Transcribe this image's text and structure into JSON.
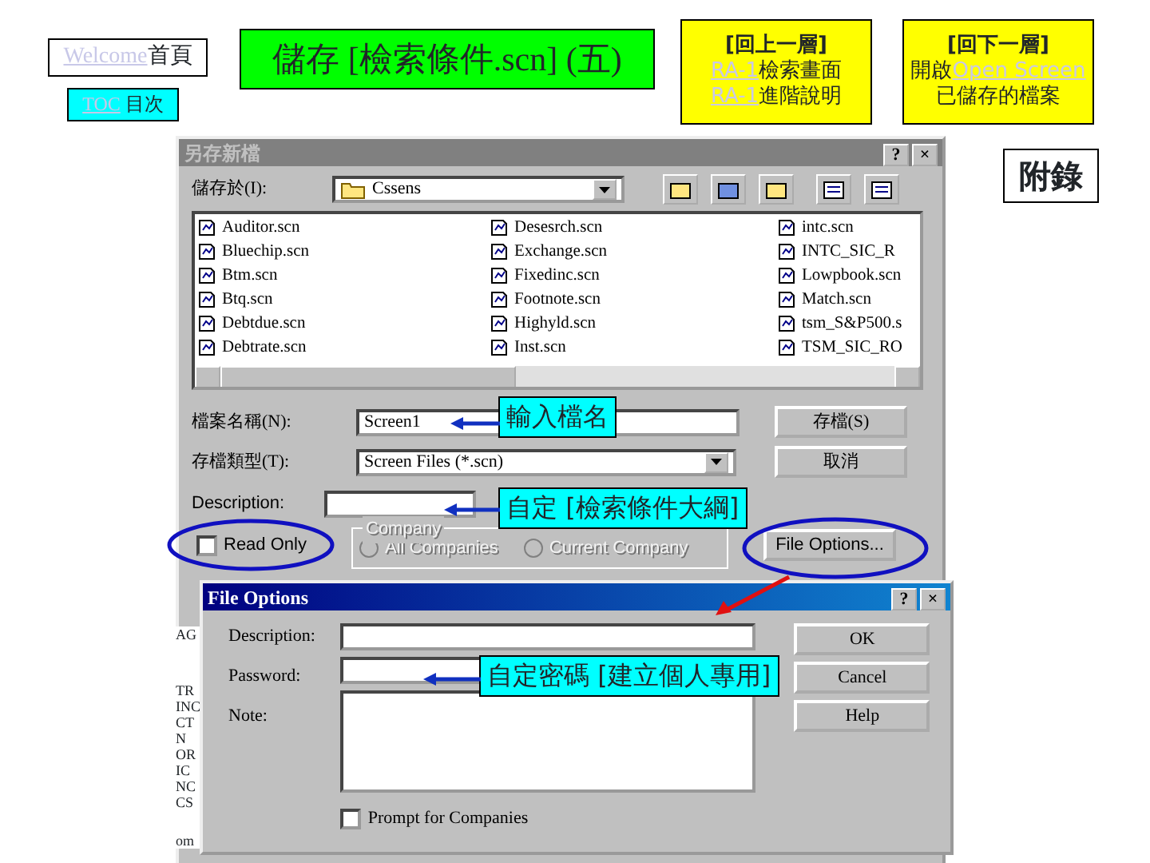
{
  "nav": {
    "home": {
      "link": "Welcome",
      "text": "首頁"
    },
    "toc": {
      "link": "TOC",
      "text": "目次"
    }
  },
  "title": "儲存 [檢索條件.scn] (五)",
  "nav_up": {
    "lines": [
      [
        {
          "kind": "bold",
          "text": "[回上一層]"
        }
      ],
      [
        {
          "kind": "link",
          "text": "RA-1"
        },
        {
          "kind": "text",
          "text": "檢索畫面"
        }
      ],
      [
        {
          "kind": "link",
          "text": "RA-1"
        },
        {
          "kind": "text",
          "text": "進階說明"
        }
      ]
    ]
  },
  "nav_down": {
    "lines": [
      [
        {
          "kind": "bold",
          "text": "[回下一層]"
        }
      ],
      [
        {
          "kind": "text",
          "text": "開啟"
        },
        {
          "kind": "link",
          "text": "Open Screen"
        }
      ],
      [
        {
          "kind": "text",
          "text": "已儲存的檔案"
        }
      ]
    ]
  },
  "appendix": "附錄",
  "save_dialog": {
    "title": "另存新檔",
    "help": "?",
    "close": "×",
    "save_in_label": "儲存於(I):",
    "folder": "Cssens",
    "files": [
      {
        "name": "Auditor.scn"
      },
      {
        "name": "Desesrch.scn"
      },
      {
        "name": "intc.scn"
      },
      {
        "name": "Bluechip.scn"
      },
      {
        "name": "Exchange.scn"
      },
      {
        "name": "INTC_SIC_R"
      },
      {
        "name": "Btm.scn"
      },
      {
        "name": "Fixedinc.scn"
      },
      {
        "name": "Lowpbook.scn"
      },
      {
        "name": "Btq.scn"
      },
      {
        "name": "Footnote.scn"
      },
      {
        "name": "Match.scn"
      },
      {
        "name": "Debtdue.scn"
      },
      {
        "name": "Highyld.scn"
      },
      {
        "name": "tsm_S&P500.s"
      },
      {
        "name": "Debtrate.scn"
      },
      {
        "name": "Inst.scn"
      },
      {
        "name": "TSM_SIC_RO"
      }
    ],
    "filename_label": "檔案名稱(N):",
    "filename": "Screen1",
    "save_button": "存檔(S)",
    "type_label": "存檔類型(T):",
    "type": "Screen Files (*.scn)",
    "cancel_button": "取消",
    "description_label": "Description:",
    "read_only": {
      "label": "Read Only",
      "checked": false
    },
    "company": {
      "label": "Company",
      "disabled": true,
      "options": [
        {
          "label": "All Companies",
          "selected": false
        },
        {
          "label": "Current Company",
          "selected": false
        }
      ]
    },
    "file_options_button": "File Options..."
  },
  "file_options_dialog": {
    "title": "File Options",
    "help": "?",
    "close": "×",
    "description_label": "Description:",
    "password_label": "Password:",
    "note_label": "Note:",
    "ok_button": "OK",
    "cancel_button": "Cancel",
    "help_button": "Help",
    "prompt": {
      "label": "Prompt for Companies",
      "checked": false
    }
  },
  "callouts": [
    {
      "text": "輸入檔名"
    },
    {
      "text": "自定 [檢索條件大綱]"
    },
    {
      "text": "自定密碼 [建立個人專用]"
    }
  ],
  "background_fragments": [
    "AG",
    "TR",
    "INC",
    "CT",
    "N",
    "OR",
    "IC",
    "NC",
    "CS",
    "om"
  ]
}
